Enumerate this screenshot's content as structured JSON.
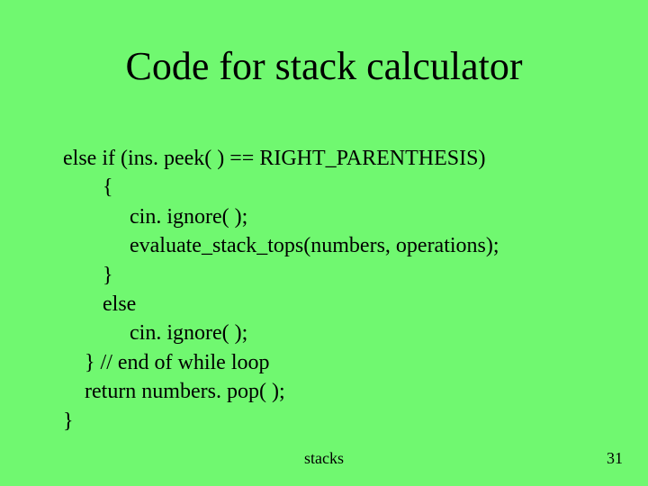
{
  "title": "Code for stack calculator",
  "code": {
    "l1": "else if (ins. peek( ) == RIGHT_PARENTHESIS)",
    "l2": "{",
    "l3": "cin. ignore( );",
    "l4": "evaluate_stack_tops(numbers, operations);",
    "l5": "}",
    "l6": "else",
    "l7": "cin. ignore( );",
    "l8": "} // end of while loop",
    "l9": "return numbers. pop( );",
    "l10": "}"
  },
  "footer": {
    "topic": "stacks",
    "page": "31"
  }
}
